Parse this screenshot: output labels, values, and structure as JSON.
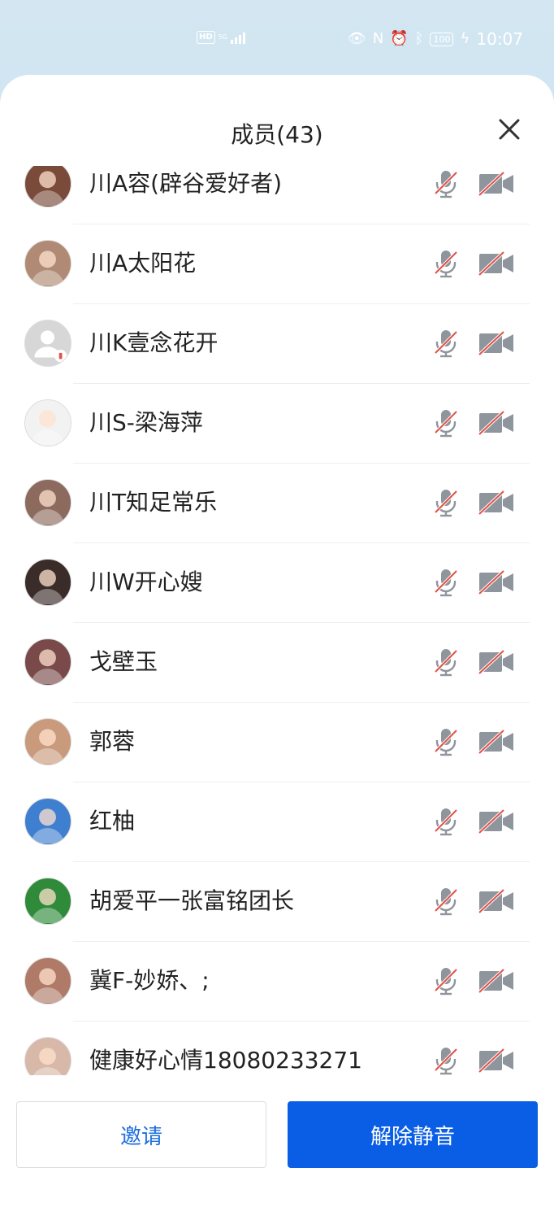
{
  "status_bar": {
    "network": "HD",
    "signal": "5G",
    "battery": "100",
    "time": "10:07"
  },
  "sheet": {
    "title": "成员(43)"
  },
  "members": [
    {
      "name": "川A容(辟谷爱好者)",
      "avatar_color": "#7a4a3a"
    },
    {
      "name": "川A太阳花",
      "avatar_color": "#b08a74"
    },
    {
      "name": "川K壹念花开",
      "avatar_color": "#d7d7d7"
    },
    {
      "name": "川S-梁海萍",
      "avatar_color": "#f2f2f2"
    },
    {
      "name": "川T知足常乐",
      "avatar_color": "#8c6a5e"
    },
    {
      "name": "川W开心嫂",
      "avatar_color": "#3a2c28"
    },
    {
      "name": "戈壁玉",
      "avatar_color": "#7a4a4a"
    },
    {
      "name": "郭蓉",
      "avatar_color": "#c99a7c"
    },
    {
      "name": "红柚",
      "avatar_color": "#3f7fd0"
    },
    {
      "name": "胡爱平一张富铭团长",
      "avatar_color": "#2f8a3a"
    },
    {
      "name": "冀F-妙娇、;",
      "avatar_color": "#b07a68"
    },
    {
      "name": "健康好心情18080233271",
      "avatar_color": "#d8b8a8"
    }
  ],
  "buttons": {
    "invite": "邀请",
    "unmute": "解除静音"
  },
  "colors": {
    "accent": "#0a5ee6",
    "muted_slash": "#e0524a",
    "icon_gray": "#8f959c"
  }
}
